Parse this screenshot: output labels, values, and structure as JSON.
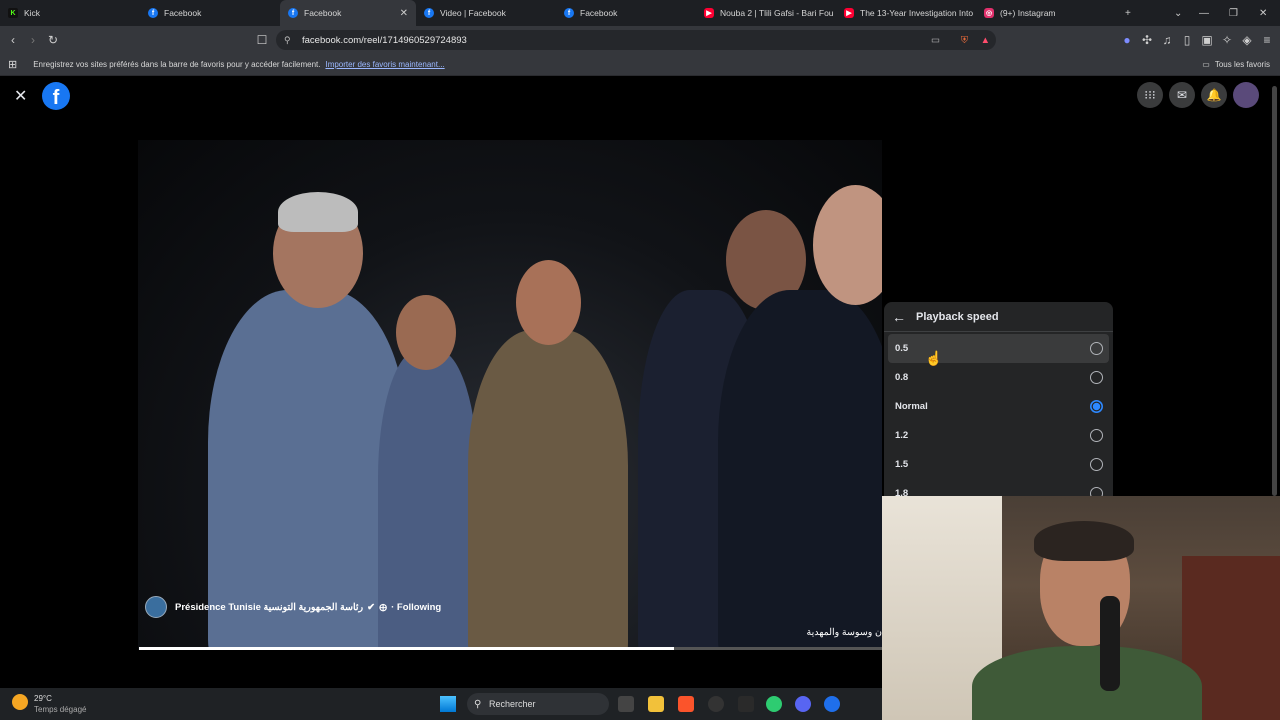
{
  "browser": {
    "tabs": [
      {
        "label": "Kick",
        "icon": "kick-icon",
        "active": false
      },
      {
        "label": "Facebook",
        "icon": "facebook-icon",
        "active": false
      },
      {
        "label": "Facebook",
        "icon": "facebook-icon",
        "active": true
      },
      {
        "label": "Video | Facebook",
        "icon": "facebook-icon",
        "active": false
      },
      {
        "label": "Facebook",
        "icon": "facebook-icon",
        "active": false
      },
      {
        "label": "Nouba 2 | Tlili Gafsi - Bari Fou",
        "icon": "youtube-icon",
        "active": false
      },
      {
        "label": "The 13-Year Investigation Into",
        "icon": "youtube-icon",
        "active": false
      },
      {
        "label": "(9+) Instagram",
        "icon": "instagram-icon",
        "active": false
      }
    ],
    "url": "facebook.com/reel/1714960529724893",
    "bookmarks_prompt": "Enregistrez vos sites préférés dans la barre de favoris pour y accéder facilement.",
    "bookmarks_import_link": "Importer des favoris maintenant...",
    "all_bookmarks": "Tous les favoris"
  },
  "video": {
    "author": "Présidence Tunisie رئاسة الجمهورية التونسية",
    "following": "· Following",
    "caption": "ن وسوسة والمهدية",
    "progress": 0.72
  },
  "playback_menu": {
    "title": "Playback speed",
    "options": [
      {
        "label": "0.5",
        "selected": false
      },
      {
        "label": "0.8",
        "selected": false
      },
      {
        "label": "Normal",
        "selected": true
      },
      {
        "label": "1.2",
        "selected": false
      },
      {
        "label": "1.5",
        "selected": false
      },
      {
        "label": "1.8",
        "selected": false
      }
    ]
  },
  "taskbar": {
    "weather_temp": "29°C",
    "weather_desc": "Temps dégagé",
    "search_placeholder": "Rechercher"
  },
  "colors": {
    "fb_blue": "#1877f2",
    "radio_selected": "#2d88ff",
    "menu_bg": "#242526"
  }
}
